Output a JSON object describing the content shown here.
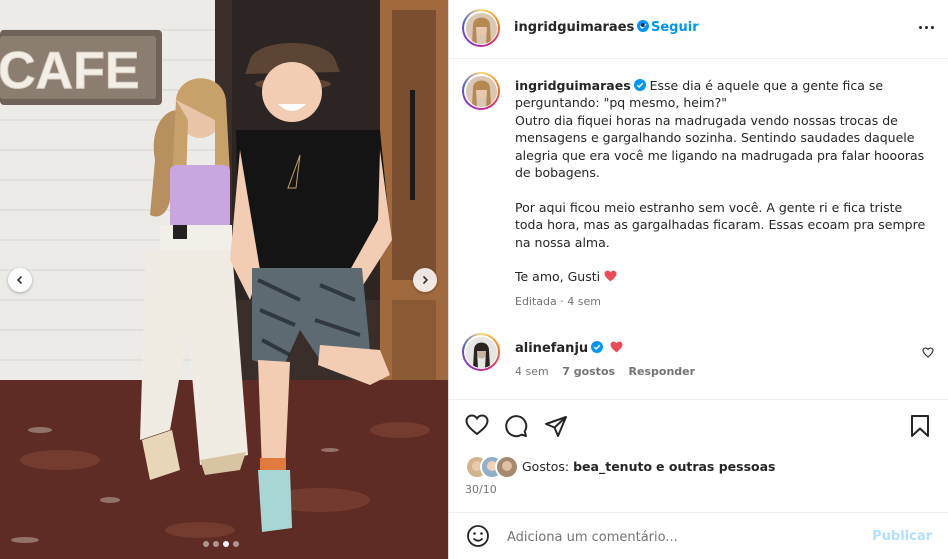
{
  "post": {
    "author": "ingridguimaraes",
    "separator": "•",
    "follow_label": "Seguir",
    "caption_lines": [
      "Esse dia é aquele que a gente fica se",
      "perguntando: \"pq mesmo, heim?\"",
      "Outro dia fiquei horas na madrugada vendo nossas trocas de",
      "mensagens e gargalhando sozinha. Sentindo saudades daquele",
      "alegria que era você me ligando na madrugada pra falar hoooras",
      "de bobagens.",
      "",
      "Por aqui ficou meio estranho sem você. A gente ri e fica triste",
      "toda hora, mas as gargalhadas ficaram. Essas ecoam pra sempre",
      "na nossa alma.",
      "",
      "Te amo, Gusti"
    ],
    "caption_meta": "Editada · 4 sem",
    "sign_text": "CAFE",
    "carousel_dots": 4,
    "carousel_active": 3
  },
  "comments": [
    {
      "user": "alinefanju",
      "time": "4 sem",
      "likes": "7 gostos",
      "reply_label": "Responder"
    }
  ],
  "likes": {
    "prefix": "Gostos:",
    "user": "bea_tenuto",
    "suffix": "e outras pessoas"
  },
  "date": "30/10",
  "comment_box": {
    "placeholder": "Adiciona um comentário...",
    "publish_label": "Publicar"
  },
  "colors": {
    "link_blue": "#0095f6",
    "verified_blue": "#0095f6",
    "heart_red": "#ed4956",
    "publish_disabled": "#b2dffc"
  },
  "icons": [
    "chevron-left-icon",
    "chevron-right-icon",
    "more-icon",
    "verified-icon",
    "heart-icon",
    "comment-icon",
    "share-icon",
    "bookmark-icon",
    "emoji-icon"
  ]
}
